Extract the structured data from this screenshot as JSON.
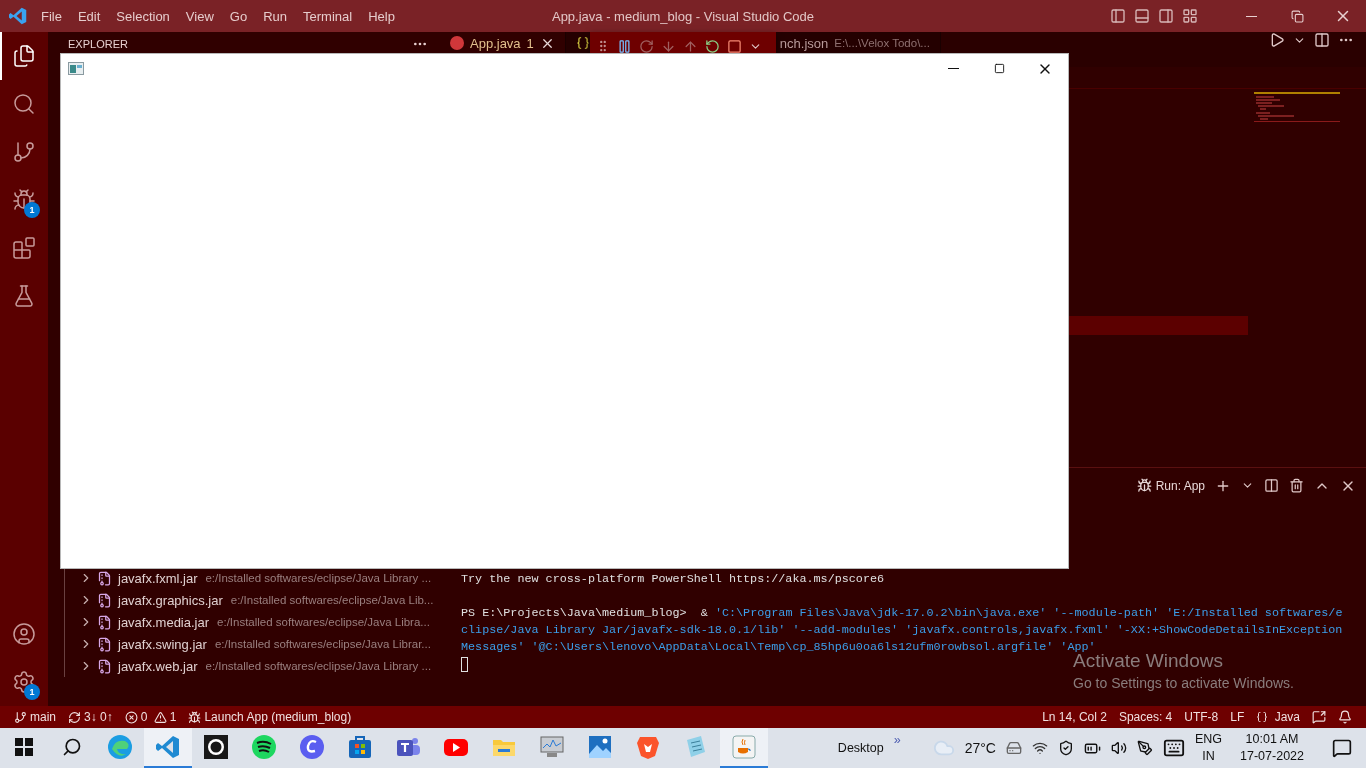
{
  "title_bar": {
    "menu": [
      "File",
      "Edit",
      "Selection",
      "View",
      "Go",
      "Run",
      "Terminal",
      "Help"
    ],
    "title": "App.java - medium_blog - Visual Studio Code"
  },
  "activity_bar": {
    "items": [
      {
        "kind": "explorer",
        "selected": true
      },
      {
        "kind": "search",
        "selected": false
      },
      {
        "kind": "source_control",
        "selected": false
      },
      {
        "kind": "run_debug",
        "selected": false,
        "badge": "1"
      },
      {
        "kind": "extensions",
        "selected": false
      },
      {
        "kind": "testing",
        "selected": false
      }
    ],
    "bottom": [
      {
        "kind": "accounts"
      },
      {
        "kind": "manage",
        "badge": "1"
      }
    ]
  },
  "sidebar": {
    "title": "EXPLORER",
    "items": [
      {
        "name": "javafx.fxml.jar",
        "path": "e:/Installed softwares/eclipse/Java Library ...",
        "expanded": false
      },
      {
        "name": "javafx.graphics.jar",
        "path": "e:/Installed softwares/eclipse/Java Lib...",
        "expanded": false
      },
      {
        "name": "javafx.media.jar",
        "path": "e:/Installed softwares/eclipse/Java Libra...",
        "expanded": false
      },
      {
        "name": "javafx.swing.jar",
        "path": "e:/Installed softwares/eclipse/Java Librar...",
        "expanded": false
      },
      {
        "name": "javafx.web.jar",
        "path": "e:/Installed softwares/eclipse/Java Library ...",
        "expanded": false
      }
    ]
  },
  "tabs": [
    {
      "kind": "java",
      "label": "App.java",
      "problems": "1",
      "selected": true
    },
    {
      "kind": "json",
      "label": "nch.json",
      "description": "E:\\...\\Velox Todo\\...",
      "selected": false
    }
  ],
  "panel": {
    "run_label": "Run: App",
    "terminal": {
      "notice": "Try the new cross-platform PowerShell https://aka.ms/pscore6",
      "prompt": "PS E:\\Projects\\Java\\medium_blog>",
      "operator": "&",
      "args": "'C:\\Program Files\\Java\\jdk-17.0.2\\bin\\java.exe' '--module-path' 'E:/Installed softwares/eclipse/Java Library Jar/javafx-sdk-18.0.1/lib' '--add-modules' 'javafx.controls,javafx.fxml' '-XX:+ShowCodeDetailsInExceptionMessages' '@C:\\Users\\lenovo\\AppData\\Local\\Temp\\cp_85hp6u0oa6ls12ufm0rowbsol.argfile' 'App'"
    }
  },
  "activation": {
    "title": "Activate Windows",
    "text": "Go to Settings to activate Windows."
  },
  "status_bar": {
    "left": [
      {
        "kind": "branch",
        "text": "main"
      },
      {
        "kind": "sync",
        "text": "3↓ 0↑"
      },
      {
        "kind": "problems",
        "errors": "0",
        "warnings": "1"
      },
      {
        "kind": "launch",
        "text": "Launch App (medium_blog)"
      }
    ],
    "right": [
      {
        "kind": "text",
        "text": "Ln 14, Col 2"
      },
      {
        "kind": "text",
        "text": "Spaces: 4"
      },
      {
        "kind": "text",
        "text": "UTF-8"
      },
      {
        "kind": "text",
        "text": "LF"
      },
      {
        "kind": "language",
        "text": "Java"
      },
      {
        "kind": "feedback"
      },
      {
        "kind": "notifications"
      }
    ]
  },
  "taskbar": {
    "apps": [
      {
        "kind": "edge",
        "active": false
      },
      {
        "kind": "vscode",
        "active": true
      },
      {
        "kind": "github",
        "active": false
      },
      {
        "kind": "spotify",
        "active": false
      },
      {
        "kind": "canva",
        "active": false
      },
      {
        "kind": "store",
        "active": false
      },
      {
        "kind": "teams",
        "active": false
      },
      {
        "kind": "youtube",
        "active": false
      },
      {
        "kind": "explorer",
        "active": false
      },
      {
        "kind": "perfmon",
        "active": false
      },
      {
        "kind": "photos",
        "active": false
      },
      {
        "kind": "brave",
        "active": false
      },
      {
        "kind": "notepad",
        "active": false
      },
      {
        "kind": "java",
        "active": true
      }
    ],
    "desktop": "Desktop",
    "chevrons": "»",
    "temperature": "27°C",
    "language": "ENG",
    "region": "IN",
    "time": "10:01 AM",
    "date": "17-07-2022"
  }
}
